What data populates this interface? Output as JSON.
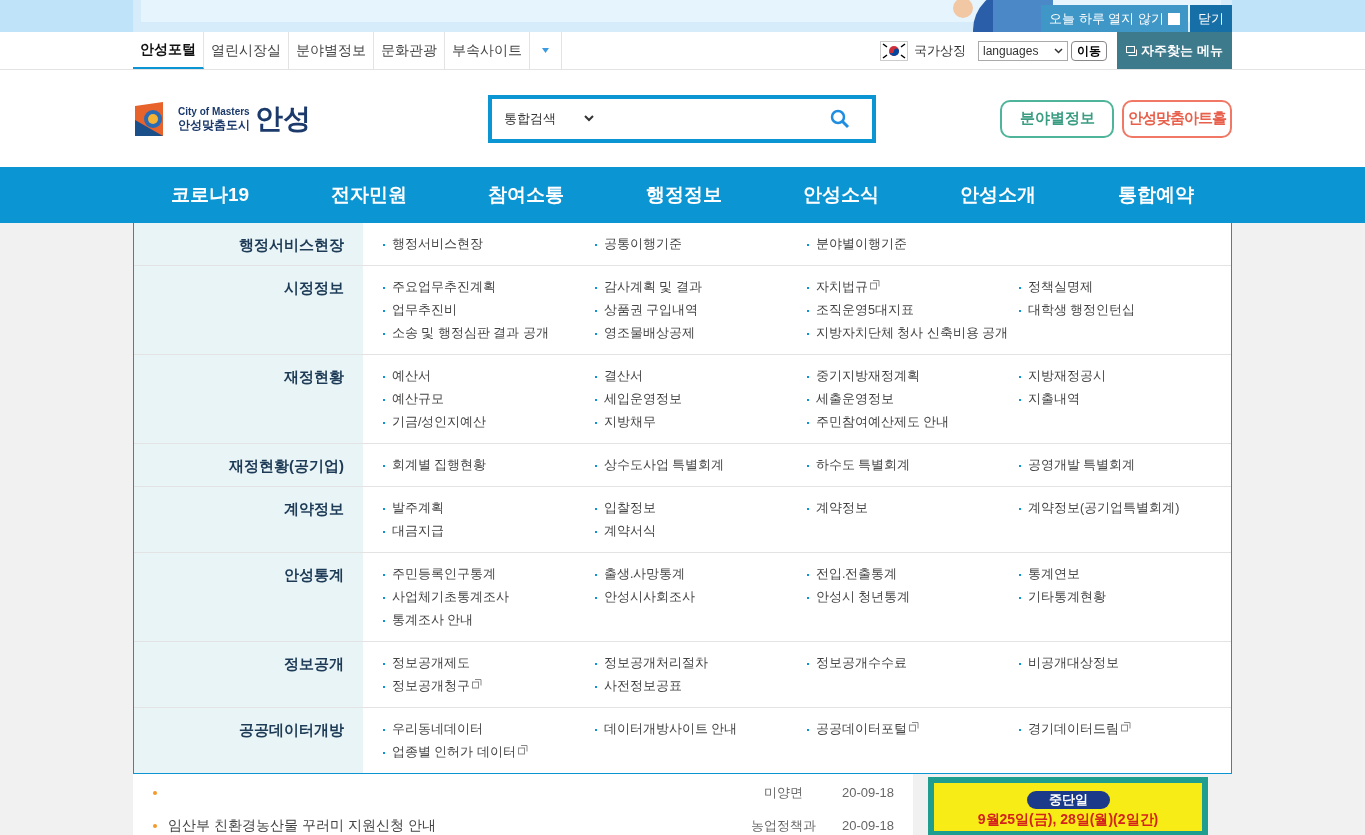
{
  "top_banner": {
    "dont_show_today": {
      "label": "오늘 하루 열지 않기",
      "checked": false
    },
    "close": "닫기"
  },
  "utility_bar": {
    "tabs": [
      {
        "label": "안성포털",
        "selected": true
      },
      {
        "label": "열린시장실",
        "selected": false
      },
      {
        "label": "분야별정보",
        "selected": false
      },
      {
        "label": "문화관광",
        "selected": false
      },
      {
        "label": "부속사이트",
        "selected": false
      }
    ],
    "national_symbol": "국가상징",
    "languages": "languages",
    "go": "이동",
    "favorites": "자주찾는 메뉴"
  },
  "header": {
    "logo": {
      "tagline": "City of Masters",
      "slogan": "안성맞춤도시",
      "name": "안성"
    },
    "search": {
      "scope": "통합검색"
    },
    "buttons": [
      "분야별정보",
      "안성맞춤아트홀"
    ]
  },
  "nav": [
    "코로나19",
    "전자민원",
    "참여소통",
    "행정정보",
    "안성소식",
    "안성소개",
    "통합예약"
  ],
  "mega_menu": [
    {
      "category": "행정서비스현장",
      "items": [
        {
          "label": "행정서비스현장",
          "external": false
        },
        {
          "label": "공통이행기준",
          "external": false
        },
        {
          "label": "분야별이행기준",
          "external": false
        }
      ]
    },
    {
      "category": "시정정보",
      "items": [
        {
          "label": "주요업무추진계획",
          "external": false
        },
        {
          "label": "감사계획 및 결과",
          "external": false
        },
        {
          "label": "자치법규",
          "external": true
        },
        {
          "label": "정책실명제",
          "external": false
        },
        {
          "label": "업무추진비",
          "external": false
        },
        {
          "label": "상품권 구입내역",
          "external": false
        },
        {
          "label": "조직운영5대지표",
          "external": false
        },
        {
          "label": "대학생 행정인턴십",
          "external": false
        },
        {
          "label": "소송 및 행정심판 결과 공개",
          "external": false
        },
        {
          "label": "영조물배상공제",
          "external": false
        },
        {
          "label": "지방자치단체 청사 신축비용 공개",
          "external": false
        }
      ]
    },
    {
      "category": "재정현황",
      "items": [
        {
          "label": "예산서",
          "external": false
        },
        {
          "label": "결산서",
          "external": false
        },
        {
          "label": "중기지방재정계획",
          "external": false
        },
        {
          "label": "지방재정공시",
          "external": false
        },
        {
          "label": "예산규모",
          "external": false
        },
        {
          "label": "세입운영정보",
          "external": false
        },
        {
          "label": "세출운영정보",
          "external": false
        },
        {
          "label": "지출내역",
          "external": false
        },
        {
          "label": "기금/성인지예산",
          "external": false
        },
        {
          "label": "지방채무",
          "external": false
        },
        {
          "label": "주민참여예산제도 안내",
          "external": false
        }
      ]
    },
    {
      "category": "재정현황(공기업)",
      "items": [
        {
          "label": "회계별 집행현황",
          "external": false
        },
        {
          "label": "상수도사업 특별회계",
          "external": false
        },
        {
          "label": "하수도 특별회계",
          "external": false
        },
        {
          "label": "공영개발 특별회계",
          "external": false
        }
      ]
    },
    {
      "category": "계약정보",
      "items": [
        {
          "label": "발주계획",
          "external": false
        },
        {
          "label": "입찰정보",
          "external": false
        },
        {
          "label": "계약정보",
          "external": false
        },
        {
          "label": "계약정보(공기업특별회계)",
          "external": false
        },
        {
          "label": "대금지급",
          "external": false
        },
        {
          "label": "계약서식",
          "external": false
        }
      ]
    },
    {
      "category": "안성통계",
      "items": [
        {
          "label": "주민등록인구통계",
          "external": false
        },
        {
          "label": "출생.사망통계",
          "external": false
        },
        {
          "label": "전입.전출통계",
          "external": false
        },
        {
          "label": "통계연보",
          "external": false
        },
        {
          "label": "사업체기초통계조사",
          "external": false
        },
        {
          "label": "안성시사회조사",
          "external": false
        },
        {
          "label": "안성시 청년통계",
          "external": false
        },
        {
          "label": "기타통계현황",
          "external": false
        },
        {
          "label": "통계조사 안내",
          "external": false
        }
      ]
    },
    {
      "category": "정보공개",
      "items": [
        {
          "label": "정보공개제도",
          "external": false
        },
        {
          "label": "정보공개처리절차",
          "external": false
        },
        {
          "label": "정보공개수수료",
          "external": false
        },
        {
          "label": "비공개대상정보",
          "external": false
        },
        {
          "label": "정보공개청구",
          "external": true
        },
        {
          "label": "사전정보공표",
          "external": false
        }
      ]
    },
    {
      "category": "공공데이터개방",
      "items": [
        {
          "label": "우리동네데이터",
          "external": false
        },
        {
          "label": "데이터개방사이트 안내",
          "external": false
        },
        {
          "label": "공공데이터포털",
          "external": true
        },
        {
          "label": "경기데이터드림",
          "external": true
        },
        {
          "label": "업종별 인허가 데이터",
          "external": true
        }
      ]
    }
  ],
  "news": [
    {
      "department": "미양면",
      "date": "20-09-18"
    },
    {
      "title": "임산부 친환경농산물 꾸러미 지원신청 안내",
      "department": "농업정책과",
      "date": "20-09-18"
    }
  ],
  "notice_banner": {
    "heading": "중단일",
    "dates": "9월25일(금), 28일(월)(2일간)"
  }
}
